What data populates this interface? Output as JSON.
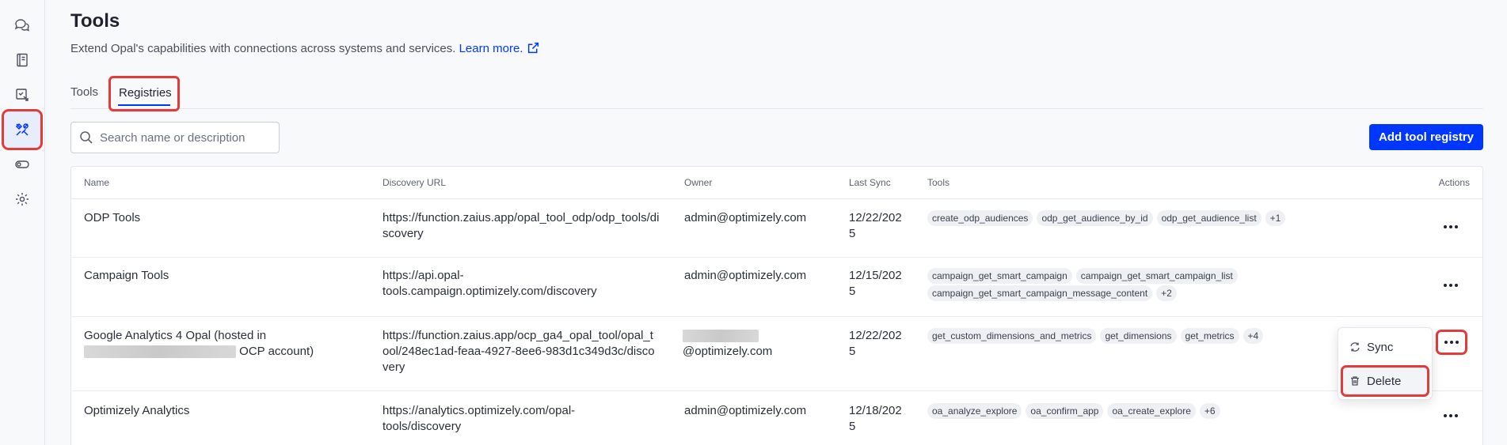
{
  "page": {
    "title": "Tools",
    "subtitle": "Extend Opal's capabilities with connections across systems and services.",
    "learn_more": "Learn more."
  },
  "tabs": [
    {
      "label": "Tools"
    },
    {
      "label": "Registries",
      "active": true
    }
  ],
  "search": {
    "placeholder": "Search name or description"
  },
  "actions": {
    "add_label": "Add tool registry"
  },
  "table": {
    "headers": {
      "name": "Name",
      "url": "Discovery URL",
      "owner": "Owner",
      "sync": "Last Sync",
      "tools": "Tools",
      "actions": "Actions"
    },
    "rows": [
      {
        "name": "ODP Tools",
        "url": "https://function.zaius.app/opal_tool_odp/odp_tools/discovery",
        "owner": "admin@optimizely.com",
        "sync": "12/22/2025",
        "tools": [
          "create_odp_audiences",
          "odp_get_audience_by_id",
          "odp_get_audience_list",
          "+1"
        ]
      },
      {
        "name": "Campaign Tools",
        "url_line1": "https://api.opal-",
        "url_line2": "tools.campaign.optimizely.com/discovery",
        "owner": "admin@optimizely.com",
        "sync": "12/15/2025",
        "tools": [
          "campaign_get_smart_campaign",
          "campaign_get_smart_campaign_list",
          "campaign_get_smart_campaign_message_content",
          "+2"
        ]
      },
      {
        "name_line1": "Google Analytics 4 Opal (hosted in",
        "name_line2_suffix": "OCP account)",
        "url": "https://function.zaius.app/ocp_ga4_opal_tool/opal_tool/248ec1ad-feaa-4927-8ee6-983d1c349d3c/discovery",
        "owner_suffix": "@optimizely.com",
        "sync": "12/22/2025",
        "tools": [
          "get_custom_dimensions_and_metrics",
          "get_dimensions",
          "get_metrics",
          "+4"
        ]
      },
      {
        "name": "Optimizely Analytics",
        "url_line1": "https://analytics.optimizely.com/opal-",
        "url_line2": "tools/discovery",
        "owner": "admin@optimizely.com",
        "sync": "12/18/2025",
        "tools": [
          "oa_analyze_explore",
          "oa_confirm_app",
          "oa_create_explore",
          "+6"
        ]
      }
    ]
  },
  "menu": {
    "sync": "Sync",
    "delete": "Delete"
  },
  "colors": {
    "accent": "#0037ff",
    "highlight": "#e43a3a"
  },
  "icons": [
    "chat-icon",
    "book-icon",
    "agent-icon",
    "tools-icon",
    "toggle-icon",
    "settings-icon",
    "search-icon",
    "external-link-icon",
    "sync-icon",
    "trash-icon",
    "more-icon"
  ]
}
